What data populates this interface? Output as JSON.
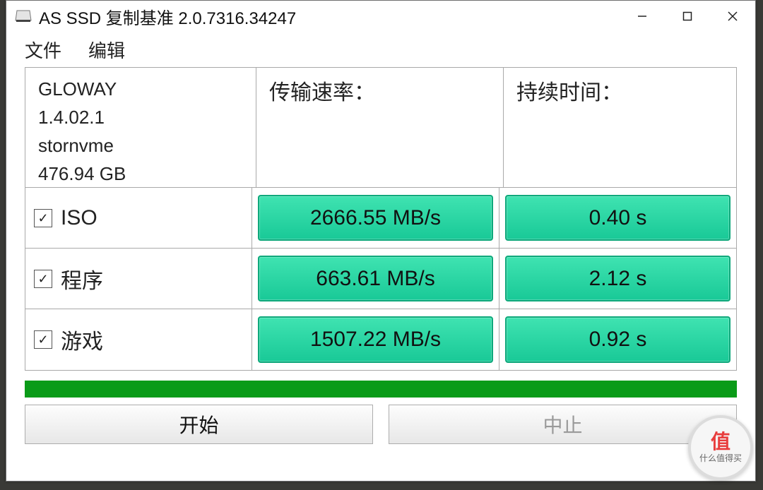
{
  "window_title": "AS SSD 复制基准 2.0.7316.34247",
  "menu": {
    "file": "文件",
    "edit": "编辑"
  },
  "drive": {
    "model": "GLOWAY",
    "firmware": "1.4.02.1",
    "driver": "stornvme",
    "capacity": "476.94 GB"
  },
  "headers": {
    "speed": "传输速率：",
    "time": "持续时间："
  },
  "tests": [
    {
      "label": "ISO",
      "checked": true,
      "speed": "2666.55 MB/s",
      "time": "0.40 s"
    },
    {
      "label": "程序",
      "checked": true,
      "speed": "663.61 MB/s",
      "time": "2.12 s"
    },
    {
      "label": "游戏",
      "checked": true,
      "speed": "1507.22 MB/s",
      "time": "0.92 s"
    }
  ],
  "buttons": {
    "start": "开始",
    "stop": "中止"
  },
  "watermark": {
    "glyph": "值",
    "caption": "什么值得买"
  }
}
